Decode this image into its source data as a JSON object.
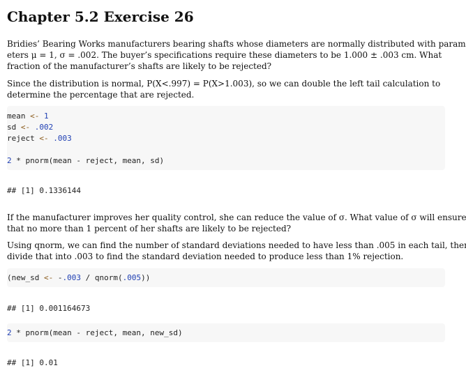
{
  "title": "Chapter 5.2 Exercise 26",
  "p1": [
    "Bridies’ Bearing Works manufacturers bearing shafts whose diameters are normally distributed with param-",
    "eters μ = 1, σ = .002.  The buyer’s specifications require these diameters to be 1.000 ± .003 cm.  What",
    "fraction of the manufacturer’s shafts are likely to be rejected?"
  ],
  "p2": [
    "Since the distribution is normal, P(X<.997) = P(X>1.003), so we can double the left tail calculation to",
    "determine the percentage that are rejected."
  ],
  "code1": {
    "line1_var": "mean",
    "line1_op": "<-",
    "line1_val": "1",
    "line2_var": "sd",
    "line2_op": "<-",
    "line2_val": ".002",
    "line3_var": "reject",
    "line3_op": "<-",
    "line3_val": ".003",
    "line4_num": "2",
    "line4_rest": " * pnorm(mean - reject, mean, sd)"
  },
  "out1": "## [1] 0.1336144",
  "p3": [
    "If the manufacturer improves her quality control, she can reduce the value of σ. What value of σ will ensure",
    "that no more than 1 percent of her shafts are likely to be rejected?"
  ],
  "p4": [
    "Using qnorm, we can find the number of standard deviations needed to have less than .005 in each tail, then",
    "divide that into .003 to find the standard deviation needed to produce less than 1% rejection."
  ],
  "code2": {
    "a": "(new_sd ",
    "op": "<-",
    "b": " -",
    "num1": ".003",
    "c": " / qnorm(",
    "num2": ".005",
    "d": "))"
  },
  "out2": "## [1] 0.001164673",
  "code3": {
    "num": "2",
    "rest": " * pnorm(mean - reject, mean, new_sd)"
  },
  "out3": "## [1] 0.01"
}
